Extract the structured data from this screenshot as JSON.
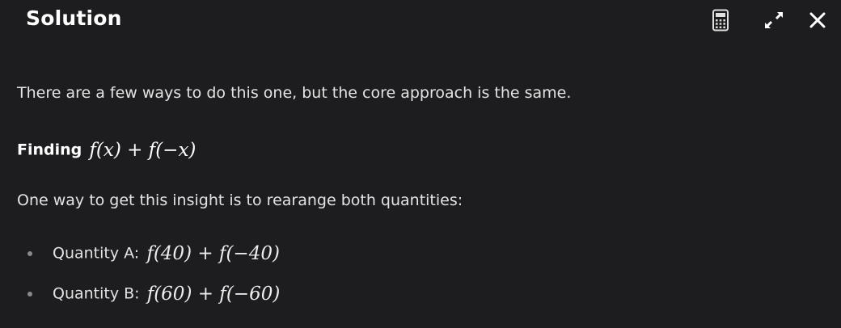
{
  "header": {
    "title": "Solution",
    "icons": {
      "calculator": "calculator-icon",
      "expand": "expand-icon",
      "close": "close-icon"
    }
  },
  "content": {
    "intro": "There are a few ways to do this one, but the core approach is the same.",
    "heading_label": "Finding",
    "heading_math": "f(x) + f(−x)",
    "insight": "One way to get this insight is to rearange both quantities:",
    "bullets": [
      {
        "label": "Quantity A:",
        "math": "f(40) + f(−40)"
      },
      {
        "label": "Quantity B:",
        "math": "f(60) + f(−60)"
      }
    ]
  },
  "colors": {
    "background": "#1d1d1f",
    "text": "#e3e3e3",
    "title": "#ffffff",
    "bullet_dot": "#8a8a8a"
  }
}
